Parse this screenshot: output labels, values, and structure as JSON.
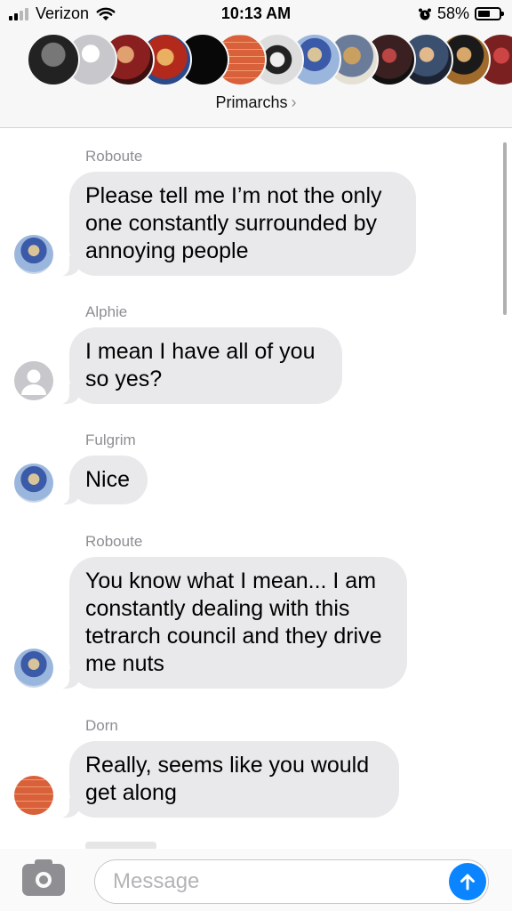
{
  "status_bar": {
    "carrier": "Verizon",
    "time": "10:13 AM",
    "battery_percent": "58%",
    "battery_level": 0.58,
    "signal_icon": "cellular-signal-icon",
    "wifi_icon": "wifi-icon",
    "alarm_icon": "alarm-clock-icon",
    "battery_icon": "battery-icon"
  },
  "header": {
    "group_name": "Primarchs",
    "chevron": "›",
    "avatar_count": 13
  },
  "messages": [
    {
      "sender": "Roboute",
      "text": "Please tell me I’m not the only one constantly surrounded by annoying people",
      "avatar": "blue-armored-avatar"
    },
    {
      "sender": "Alphie",
      "text": "I mean I have all of you so yes?",
      "avatar": "default-contact-avatar"
    },
    {
      "sender": "Fulgrim",
      "text": "Nice",
      "avatar": "blue-armored-avatar"
    },
    {
      "sender": "Roboute",
      "text": "You know what I mean... I am constantly dealing with this tetrarch council and they drive me nuts",
      "avatar": "blue-armored-avatar"
    },
    {
      "sender": "Dorn",
      "text": "Really, seems like you would get along",
      "avatar": "brick-wall-avatar"
    }
  ],
  "input": {
    "placeholder": "Message",
    "value": "",
    "camera_icon": "camera-icon",
    "send_icon": "send-arrow-icon"
  },
  "colors": {
    "bubble_incoming": "#e9e9eb",
    "accent": "#0a84ff",
    "secondary_text": "#8e8e93"
  }
}
